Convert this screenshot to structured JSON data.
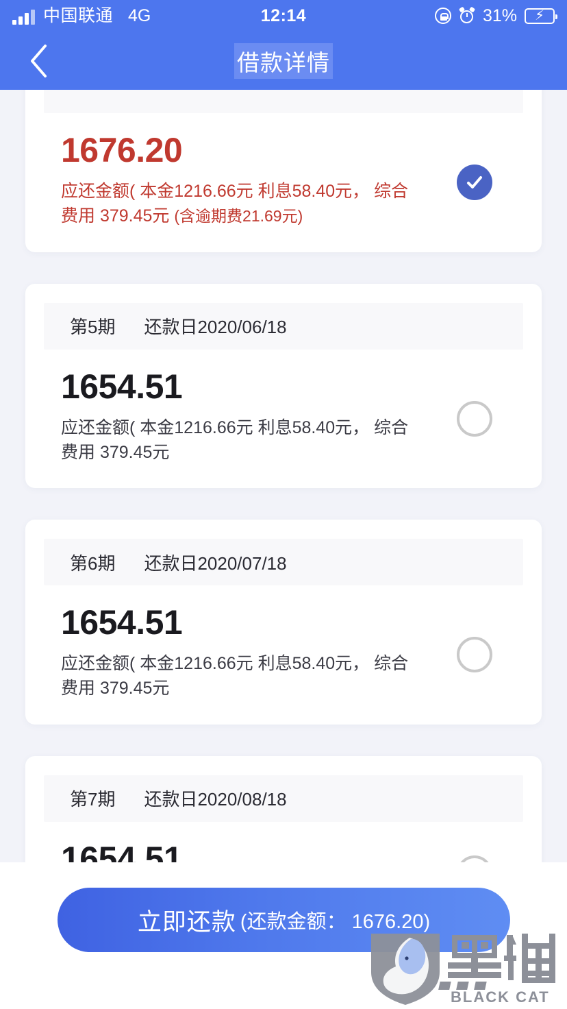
{
  "status_bar": {
    "carrier": "中国联通",
    "network": "4G",
    "time": "12:14",
    "battery_percent": "31%",
    "icons": [
      "signal-icon",
      "rotation-lock-icon",
      "alarm-clock-icon",
      "battery-charging-icon"
    ]
  },
  "nav": {
    "back_icon": "chevron-left-icon",
    "title": "借款详情"
  },
  "colors": {
    "brand_blue": "#4d76ee",
    "page_background": "#f2f3f9",
    "card_background": "#ffffff",
    "overdue_red": "#c0392f",
    "selected_radio": "#4a63c4",
    "unselected_radio": "#c9c9c9",
    "button_gradient_start": "#3f62e2",
    "button_gradient_end": "#5f8df3",
    "battery_green": "#3fcc52"
  },
  "installments": [
    {
      "term": "",
      "due_date_label": "",
      "amount": "1676.20",
      "breakdown": "应还金额( 本金1216.66元 利息58.40元， 综合费用 379.45元",
      "late_fee_note": "(含逾期费21.69元)",
      "overdue": true,
      "selected": true,
      "clipped": true
    },
    {
      "term": "第5期",
      "due_date_label": "还款日2020/06/18",
      "amount": "1654.51",
      "breakdown": "应还金额( 本金1216.66元 利息58.40元， 综合费用 379.45元",
      "late_fee_note": "",
      "overdue": false,
      "selected": false,
      "clipped": false
    },
    {
      "term": "第6期",
      "due_date_label": "还款日2020/07/18",
      "amount": "1654.51",
      "breakdown": "应还金额( 本金1216.66元 利息58.40元， 综合费用 379.45元",
      "late_fee_note": "",
      "overdue": false,
      "selected": false,
      "clipped": false
    },
    {
      "term": "第7期",
      "due_date_label": "还款日2020/08/18",
      "amount": "1654.51",
      "breakdown": "",
      "late_fee_note": "",
      "overdue": false,
      "selected": false,
      "clipped": false
    }
  ],
  "bottom_bar": {
    "pay_main_label": "立即还款",
    "pay_sub_label": "(还款金额： 1676.20)"
  },
  "watermark": {
    "cn_text": "黑猫",
    "en_text": "BLACK CAT"
  }
}
